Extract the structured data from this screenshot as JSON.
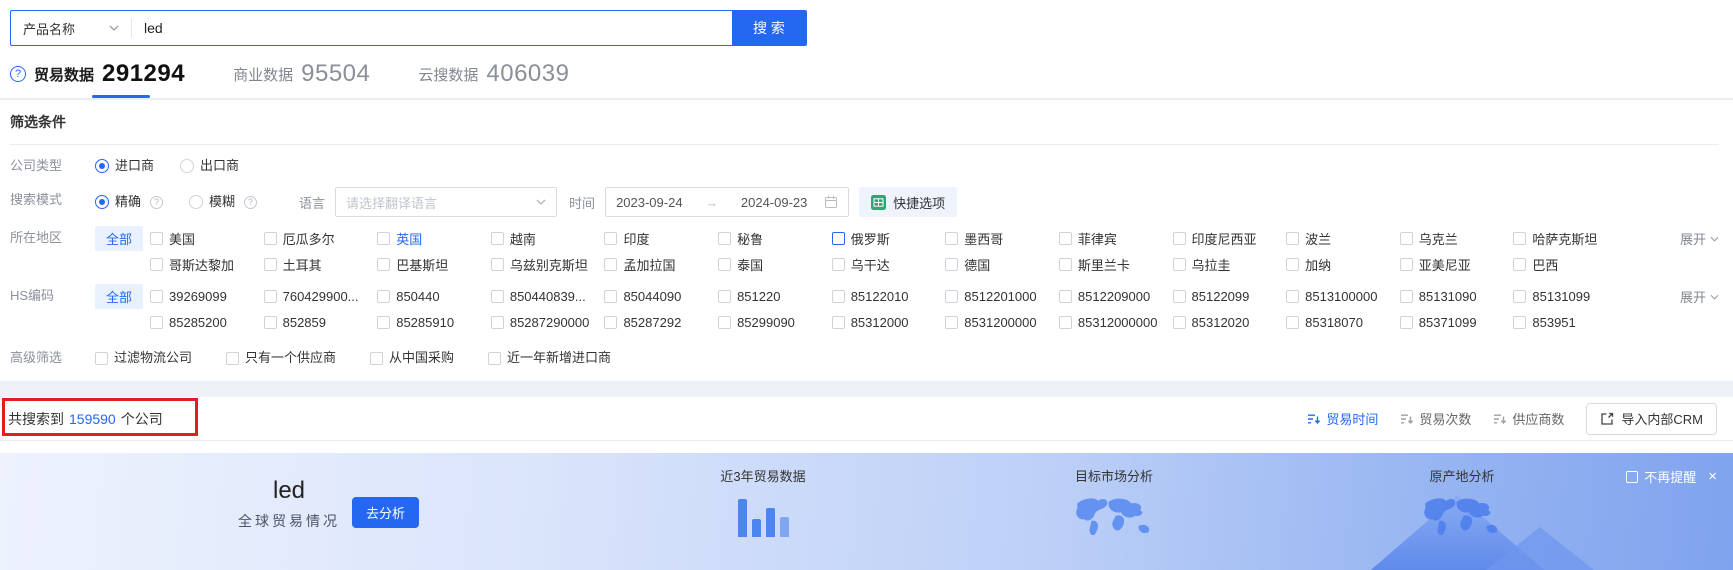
{
  "search": {
    "category": "产品名称",
    "query": "led",
    "button": "搜 索"
  },
  "tabs": [
    {
      "label": "贸易数据",
      "count": "291294"
    },
    {
      "label": "商业数据",
      "count": "95504"
    },
    {
      "label": "云搜数据",
      "count": "406039"
    }
  ],
  "filters": {
    "title": "筛选条件",
    "company_type": {
      "label": "公司类型",
      "option1": "进口商",
      "option2": "出口商"
    },
    "search_mode": {
      "label": "搜索模式",
      "option1": "精确",
      "option2": "模糊"
    },
    "language": {
      "label": "语言",
      "placeholder": "请选择翻译语言"
    },
    "time": {
      "label": "时间",
      "start": "2023-09-24",
      "arrow": "→",
      "end": "2024-09-23"
    },
    "quick_option": "快捷选项",
    "region": {
      "label": "所在地区",
      "all": "全部",
      "expand": "展开",
      "row1": [
        {
          "label": "美国"
        },
        {
          "label": "厄瓜多尔"
        },
        {
          "label": "英国",
          "state": "blue-text"
        },
        {
          "label": "越南"
        },
        {
          "label": "印度"
        },
        {
          "label": "秘鲁"
        },
        {
          "label": "俄罗斯",
          "state": "blue-box"
        },
        {
          "label": "墨西哥"
        },
        {
          "label": "菲律宾"
        },
        {
          "label": "印度尼西亚"
        },
        {
          "label": "波兰"
        },
        {
          "label": "乌克兰"
        },
        {
          "label": "哈萨克斯坦"
        }
      ],
      "row2": [
        {
          "label": "哥斯达黎加"
        },
        {
          "label": "土耳其"
        },
        {
          "label": "巴基斯坦"
        },
        {
          "label": "乌兹别克斯坦"
        },
        {
          "label": "孟加拉国"
        },
        {
          "label": "泰国"
        },
        {
          "label": "乌干达"
        },
        {
          "label": "德国"
        },
        {
          "label": "斯里兰卡"
        },
        {
          "label": "乌拉圭"
        },
        {
          "label": "加纳"
        },
        {
          "label": "亚美尼亚"
        },
        {
          "label": "巴西"
        }
      ]
    },
    "hs_code": {
      "label": "HS编码",
      "all": "全部",
      "expand": "展开",
      "row1": [
        {
          "label": "39269099"
        },
        {
          "label": "760429900..."
        },
        {
          "label": "850440"
        },
        {
          "label": "850440839..."
        },
        {
          "label": "85044090"
        },
        {
          "label": "851220"
        },
        {
          "label": "85122010"
        },
        {
          "label": "8512201000"
        },
        {
          "label": "8512209000"
        },
        {
          "label": "85122099"
        },
        {
          "label": "8513100000"
        },
        {
          "label": "85131090"
        },
        {
          "label": "85131099"
        }
      ],
      "row2": [
        {
          "label": "85285200"
        },
        {
          "label": "852859"
        },
        {
          "label": "85285910"
        },
        {
          "label": "85287290000"
        },
        {
          "label": "85287292"
        },
        {
          "label": "85299090"
        },
        {
          "label": "85312000"
        },
        {
          "label": "8531200000"
        },
        {
          "label": "85312000000"
        },
        {
          "label": "85312020"
        },
        {
          "label": "85318070"
        },
        {
          "label": "85371099"
        },
        {
          "label": "853951"
        }
      ]
    },
    "advanced": {
      "label": "高级筛选",
      "options": [
        {
          "label": "过滤物流公司"
        },
        {
          "label": "只有一个供应商"
        },
        {
          "label": "从中国采购"
        },
        {
          "label": "近一年新增进口商"
        }
      ]
    }
  },
  "results": {
    "prefix": "共搜索到",
    "count": "159590",
    "suffix": "个公司",
    "sorts": [
      {
        "label": "贸易时间",
        "state": "active"
      },
      {
        "label": "贸易次数"
      },
      {
        "label": "供应商数"
      }
    ],
    "crm_button": "导入内部CRM"
  },
  "banner": {
    "keyword": "led",
    "subtitle": "全球贸易情况",
    "analyze": "去分析",
    "feature1": "近3年贸易数据",
    "feature2": "目标市场分析",
    "feature3": "原产地分析",
    "dismiss": "不再提醒",
    "close": "×"
  },
  "colors": {
    "primary": "#2468F2",
    "red_annotation": "#E01E1E",
    "quick_icon_green": "#2AA876",
    "banner_bar": "#4D85F0",
    "all_tag_bg": "#E8F1FD"
  }
}
